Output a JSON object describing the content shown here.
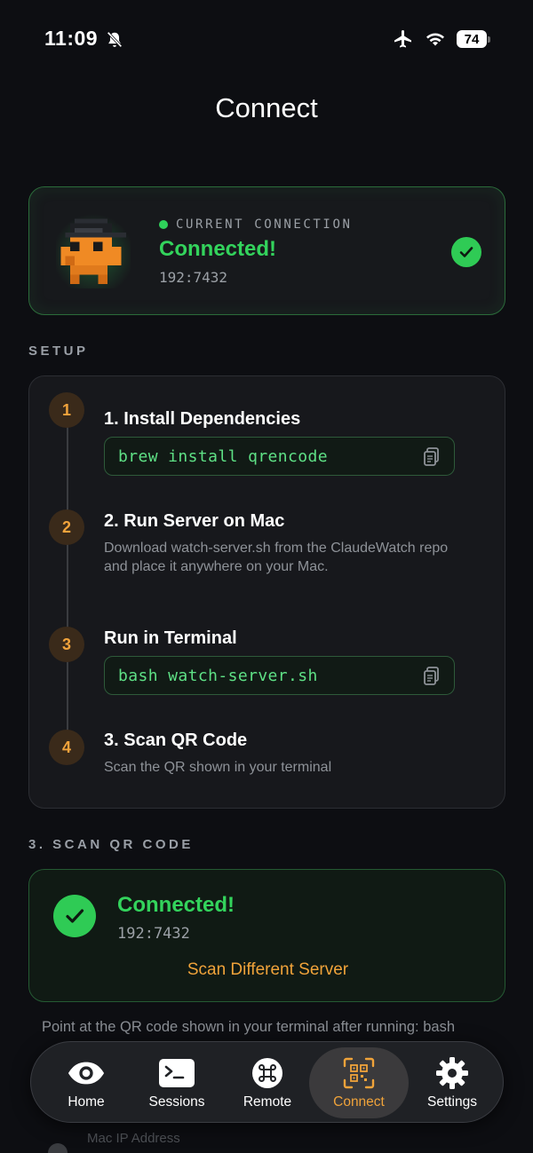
{
  "status_bar": {
    "time": "11:09",
    "battery": "74"
  },
  "page": {
    "title": "Connect"
  },
  "current_connection": {
    "label": "CURRENT CONNECTION",
    "status": "Connected!",
    "address": "192:7432"
  },
  "setup": {
    "section_label": "SETUP",
    "steps": [
      {
        "number": "1",
        "title": "1. Install Dependencies",
        "command": "brew install qrencode"
      },
      {
        "number": "2",
        "title": "2. Run Server on Mac",
        "description": "Download watch-server.sh from the ClaudeWatch repo and place it anywhere on your Mac."
      },
      {
        "number": "3",
        "title": "Run in Terminal",
        "command": "bash watch-server.sh"
      },
      {
        "number": "4",
        "title": "3. Scan QR Code",
        "description": "Scan the QR shown in your terminal"
      }
    ]
  },
  "scan": {
    "section_label": "3. SCAN QR CODE",
    "status": "Connected!",
    "address": "192:7432",
    "action_label": "Scan Different Server",
    "hint": "Point at the QR code shown in your terminal after running: bash"
  },
  "faded": {
    "label": "Mac IP Address"
  },
  "colors": {
    "accent": "#f0a33a",
    "success": "#33d35c",
    "background": "#0d0e12"
  },
  "tab_bar": {
    "active": "connect",
    "tabs": [
      {
        "id": "home",
        "label": "Home",
        "icon": "eye-icon"
      },
      {
        "id": "sessions",
        "label": "Sessions",
        "icon": "terminal-icon"
      },
      {
        "id": "remote",
        "label": "Remote",
        "icon": "command-icon"
      },
      {
        "id": "connect",
        "label": "Connect",
        "icon": "qr-scan-icon"
      },
      {
        "id": "settings",
        "label": "Settings",
        "icon": "gear-icon"
      }
    ]
  }
}
